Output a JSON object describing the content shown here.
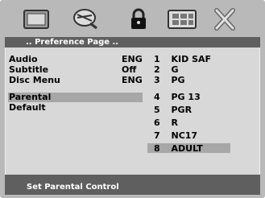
{
  "icons": [
    "picture-icon",
    "disc-icon",
    "lock-icon",
    "preview-icon",
    "close-icon"
  ],
  "header": {
    "title": ".. Preference Page .."
  },
  "menu": {
    "items": [
      {
        "label": "Audio",
        "value": "ENG"
      },
      {
        "label": "Subtitle",
        "value": "Off"
      },
      {
        "label": "Disc Menu",
        "value": "ENG"
      },
      {
        "label": "Parental",
        "value": ""
      },
      {
        "label": "Default",
        "value": ""
      }
    ]
  },
  "parental_options": [
    {
      "num": "1",
      "label": "KID SAF"
    },
    {
      "num": "2",
      "label": "G"
    },
    {
      "num": "3",
      "label": "PG"
    },
    {
      "num": "4",
      "label": "PG 13"
    },
    {
      "num": "5",
      "label": "PGR"
    },
    {
      "num": "6",
      "label": "R"
    },
    {
      "num": "7",
      "label": "NC17"
    },
    {
      "num": "8",
      "label": "ADULT"
    }
  ],
  "footer": {
    "text": "Set Parental Control"
  }
}
